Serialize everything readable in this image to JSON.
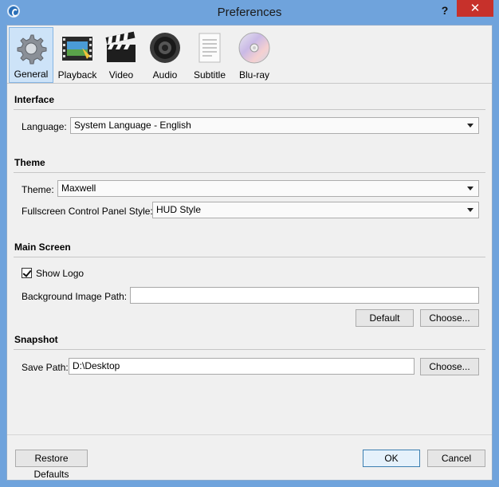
{
  "window": {
    "title": "Preferences",
    "help": "?",
    "close": "✕"
  },
  "tabs": [
    {
      "label": "General",
      "icon": "gear-icon",
      "active": true
    },
    {
      "label": "Playback",
      "icon": "film-strip-icon",
      "active": false
    },
    {
      "label": "Video",
      "icon": "clapperboard-icon",
      "active": false
    },
    {
      "label": "Audio",
      "icon": "speaker-icon",
      "active": false
    },
    {
      "label": "Subtitle",
      "icon": "document-icon",
      "active": false
    },
    {
      "label": "Blu-ray",
      "icon": "disc-icon",
      "active": false
    }
  ],
  "interface": {
    "title": "Interface",
    "language_label": "Language:",
    "language_value": "System Language - English"
  },
  "theme": {
    "title": "Theme",
    "theme_label": "Theme:",
    "theme_value": "Maxwell",
    "fullscreen_label": "Fullscreen Control Panel Style:",
    "fullscreen_value": "HUD Style"
  },
  "main_screen": {
    "title": "Main Screen",
    "show_logo_label": "Show Logo",
    "show_logo_checked": true,
    "bg_label": "Background Image Path:",
    "bg_value": "",
    "default_button": "Default",
    "choose_button": "Choose..."
  },
  "snapshot": {
    "title": "Snapshot",
    "save_path_label": "Save Path:",
    "save_path_value": "D:\\Desktop",
    "choose_button": "Choose..."
  },
  "footer": {
    "restore_defaults": "Restore Defaults",
    "ok": "OK",
    "cancel": "Cancel"
  },
  "colors": {
    "title_bar": "#6fa3dc",
    "close_button": "#c7312b",
    "active_tab": "#cde3f8"
  }
}
